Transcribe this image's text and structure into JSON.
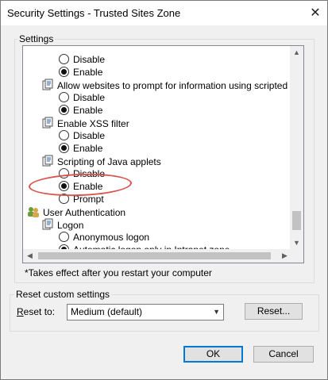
{
  "window": {
    "title": "Security Settings - Trusted Sites Zone",
    "close_glyph": "✕"
  },
  "settings_group": {
    "legend": "Settings"
  },
  "list": [
    {
      "kind": "radio",
      "label": "Disable",
      "checked": false
    },
    {
      "kind": "radio",
      "label": "Enable",
      "checked": true
    },
    {
      "kind": "category",
      "label": "Allow websites to prompt for information using scripted windo"
    },
    {
      "kind": "radio",
      "label": "Disable",
      "checked": false
    },
    {
      "kind": "radio",
      "label": "Enable",
      "checked": true
    },
    {
      "kind": "category",
      "label": "Enable XSS filter"
    },
    {
      "kind": "radio",
      "label": "Disable",
      "checked": false
    },
    {
      "kind": "radio",
      "label": "Enable",
      "checked": true
    },
    {
      "kind": "category",
      "label": "Scripting of Java applets"
    },
    {
      "kind": "radio",
      "label": "Disable",
      "checked": false
    },
    {
      "kind": "radio",
      "label": "Enable",
      "checked": true
    },
    {
      "kind": "radio",
      "label": "Prompt",
      "checked": false
    },
    {
      "kind": "top-category",
      "label": "User Authentication"
    },
    {
      "kind": "category",
      "label": "Logon"
    },
    {
      "kind": "radio",
      "label": "Anonymous logon",
      "checked": false
    },
    {
      "kind": "radio",
      "label": "Automatic logon only in Intranet zone",
      "checked": true
    }
  ],
  "note": "*Takes effect after you restart your computer",
  "reset_group": {
    "legend": "Reset custom settings",
    "reset_to_label": "Reset to:",
    "reset_to_underline": "R",
    "dropdown_value": "Medium (default)",
    "reset_button": "Reset..."
  },
  "buttons": {
    "ok": "OK",
    "cancel": "Cancel"
  },
  "colors": {
    "highlight_oval": "#d9534f",
    "accent": "#0078d7"
  }
}
